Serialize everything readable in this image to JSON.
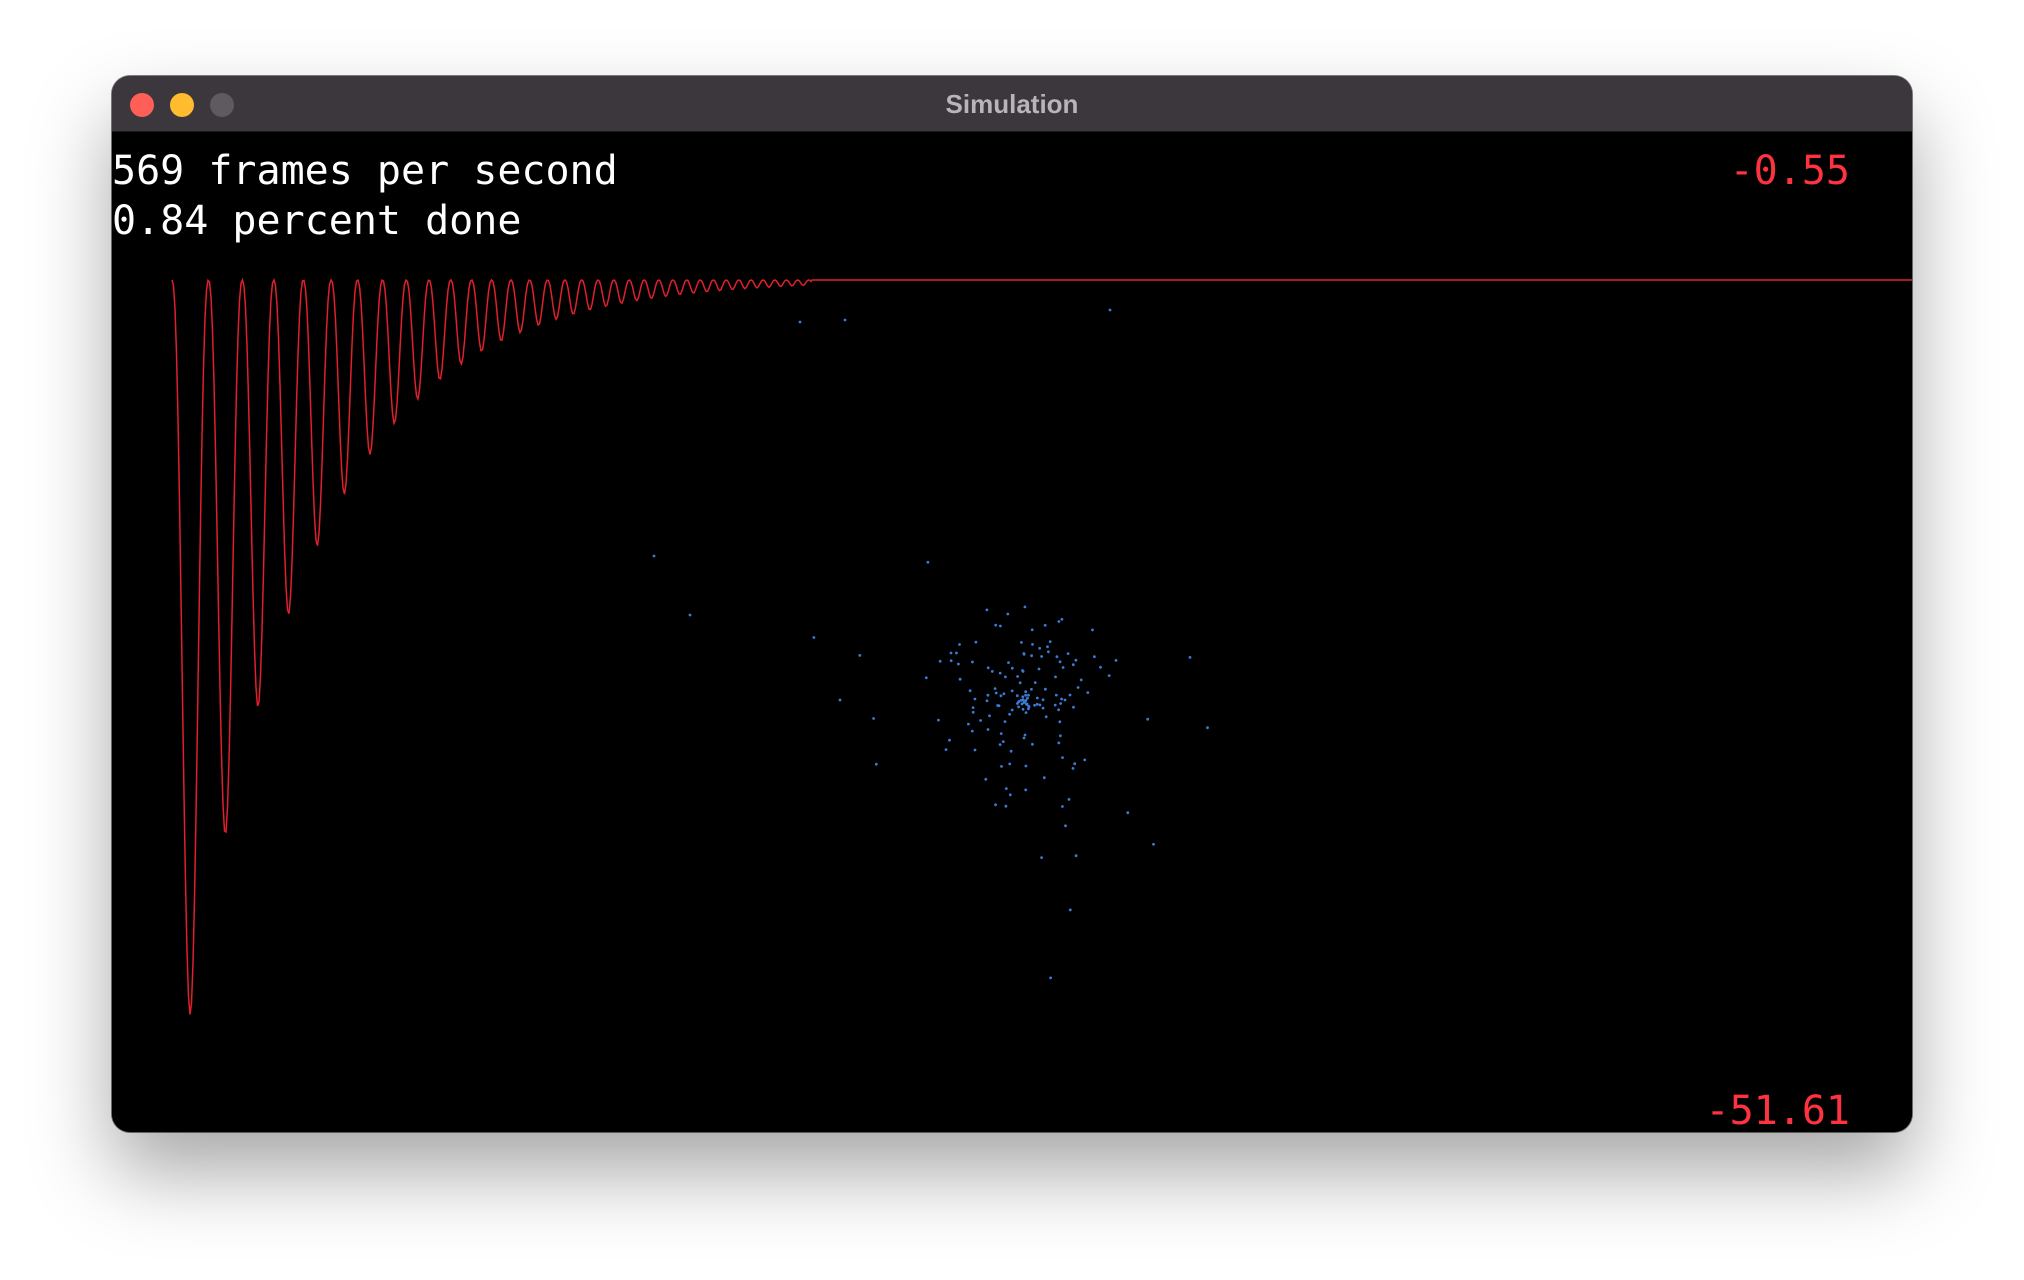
{
  "window": {
    "title": "Simulation"
  },
  "hud": {
    "fps_text": "569 frames per second",
    "progress_text": "0.84 percent done"
  },
  "plot": {
    "y_max_label": "-0.55",
    "y_min_label": "-51.61",
    "line_color": "#e0202c",
    "label_color": "#ff3340"
  },
  "particles": {
    "color": "#3a7bd5",
    "count": 160
  },
  "colors": {
    "background": "#000000",
    "titlebar": "#3b373d",
    "close": "#ff5f57",
    "minimize": "#febc2e",
    "zoom_inactive": "#5e5a60"
  },
  "chart_data": {
    "type": "line",
    "series": [
      {
        "values": []
      }
    ],
    "ylim": [
      -51.61,
      -0.55
    ]
  }
}
